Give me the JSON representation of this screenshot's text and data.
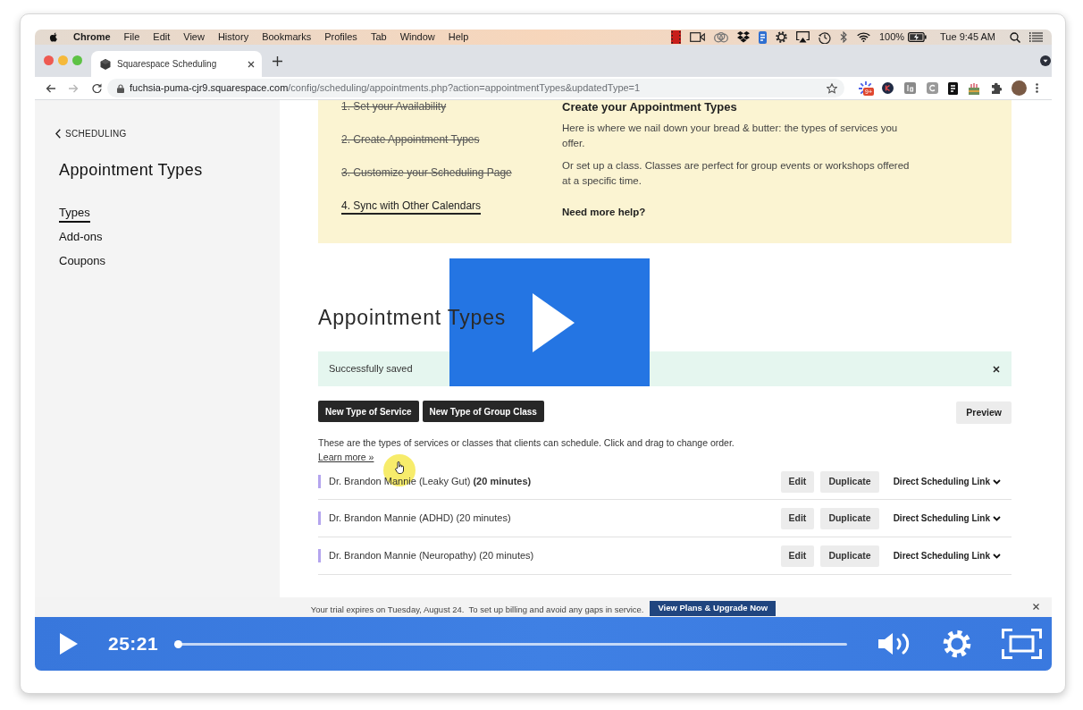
{
  "menu_bar": {
    "app_menu": "Chrome",
    "menus": [
      "File",
      "Edit",
      "View",
      "History",
      "Bookmarks",
      "Profiles",
      "Tab",
      "Window",
      "Help"
    ],
    "battery_percent": "100%",
    "clock": "Tue 9:45 AM"
  },
  "browser": {
    "tab": {
      "title": "Squarespace Scheduling"
    },
    "url": {
      "domain": "fuchsia-puma-cjr9.squarespace.com",
      "path": "/config/scheduling/appointments.php?action=appointmentTypes&updatedType=1"
    },
    "extension_badge": "9+"
  },
  "sidebar": {
    "back_link": "SCHEDULING",
    "title": "Appointment Types",
    "items": [
      {
        "label": "Types",
        "selected": true
      },
      {
        "label": "Add-ons",
        "selected": false
      },
      {
        "label": "Coupons",
        "selected": false
      }
    ]
  },
  "setup_steps": [
    {
      "label": "1. Set your Availability",
      "completed": true,
      "selected": false
    },
    {
      "label": "2. Create Appointment Types",
      "completed": true,
      "selected": false
    },
    {
      "label": "3. Customize your Scheduling Page",
      "completed": true,
      "selected": false
    },
    {
      "label": "4. Sync with Other Calendars",
      "completed": false,
      "selected": true
    }
  ],
  "help_panel": {
    "title": "Create your Appointment Types",
    "paragraphs": [
      "Here is where we nail down your bread & butter: the types of services you offer.",
      "Or set up a class. Classes are perfect for group events or workshops offered at a specific time."
    ],
    "help_link": "Need more help?"
  },
  "heading": "Appointment Types",
  "alert": {
    "message": "Successfully saved"
  },
  "create_buttons": [
    "New Type of Service",
    "New Type of Group Class"
  ],
  "preview_button": "Preview",
  "description": "These are the types of services or classes that clients can schedule. Click and drag to change order.",
  "learn_more_link": "Learn more »",
  "appointment_types": [
    {
      "name": "Dr. Brandon Mannie (Leaky Gut) **(20 minutes)**",
      "color": "#b4a5ee",
      "actions": [
        "Edit",
        "Duplicate"
      ],
      "link_menu": "Direct Scheduling Link"
    },
    {
      "name": "Dr. Brandon Mannie (ADHD) (20 minutes)",
      "color": "#b4a5ee",
      "actions": [
        "Edit",
        "Duplicate"
      ],
      "link_menu": "Direct Scheduling Link"
    },
    {
      "name": "Dr. Brandon Mannie (Neuropathy) (20 minutes)",
      "color": "#b4a5ee",
      "actions": [
        "Edit",
        "Duplicate"
      ],
      "link_menu": "Direct Scheduling Link"
    }
  ],
  "trial_banner": {
    "message": "Your trial expires on Tuesday, August 24.  To set up billing and avoid any gaps in service.",
    "button": "View Plans & Upgrade Now"
  },
  "video_player": {
    "time": "25:21",
    "progress": {
      "level": 0
    }
  }
}
